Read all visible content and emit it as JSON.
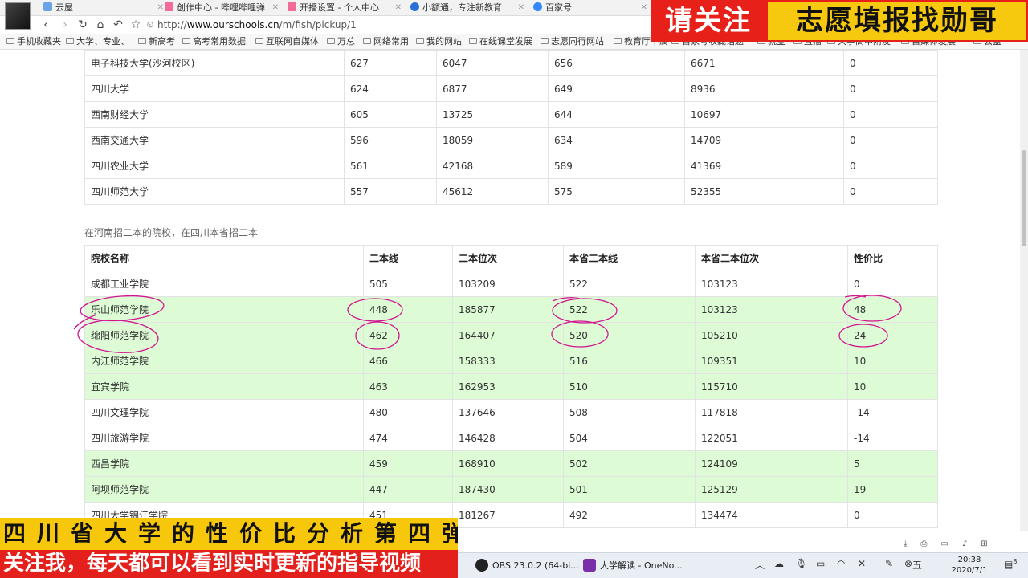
{
  "browser": {
    "tabs": [
      {
        "label": "云屋",
        "color": "#6aa3e8"
      },
      {
        "label": "创作中心 - 哔哩哔哩弹",
        "color": "#f36b9a"
      },
      {
        "label": "开播设置 - 个人中心",
        "color": "#f36b9a"
      },
      {
        "label": "小额通，专注新教育",
        "color": "#2b6fd8"
      },
      {
        "label": "百家号",
        "color": "#3388ff"
      }
    ],
    "url_protocol": "http://",
    "url_host": "www.ourschools.cn",
    "url_path": "/m/fish/pickup/1",
    "bookmarks": [
      "手机收藏夹",
      "大学、专业、",
      "新高考",
      "高考常用数据",
      "互联网自媒体",
      "万总",
      "网络常用",
      "我的网站",
      "在线课堂发展",
      "志愿同行网站",
      "教育厅下属",
      "百家号收藏话题",
      "就业",
      "直播",
      "大学高中附友",
      "自媒体发展",
      "云盘"
    ]
  },
  "overlay": {
    "top_red": "请关注",
    "top_yellow": "志愿填报找勋哥",
    "bottom_yellow": "四川省大学的性价比分析第四弹",
    "bottom_red": "关注我，每天都可以看到实时更新的指导视频"
  },
  "table1": {
    "rows": [
      [
        "电子科技大学(沙河校区)",
        "627",
        "6047",
        "656",
        "6671",
        "0"
      ],
      [
        "四川大学",
        "624",
        "6877",
        "649",
        "8936",
        "0"
      ],
      [
        "西南财经大学",
        "605",
        "13725",
        "644",
        "10697",
        "0"
      ],
      [
        "西南交通大学",
        "596",
        "18059",
        "634",
        "14709",
        "0"
      ],
      [
        "四川农业大学",
        "561",
        "42168",
        "589",
        "41369",
        "0"
      ],
      [
        "四川师范大学",
        "557",
        "45612",
        "575",
        "52355",
        "0"
      ]
    ]
  },
  "table2": {
    "caption": "在河南招二本的院校，在四川本省招二本",
    "headers": [
      "院校名称",
      "二本线",
      "二本位次",
      "本省二本线",
      "本省二本位次",
      "性价比"
    ],
    "rows": [
      {
        "cells": [
          "成都工业学院",
          "505",
          "103209",
          "522",
          "103123",
          "0"
        ],
        "hl": false
      },
      {
        "cells": [
          "乐山师范学院",
          "448",
          "185877",
          "522",
          "103123",
          "48"
        ],
        "hl": true
      },
      {
        "cells": [
          "绵阳师范学院",
          "462",
          "164407",
          "520",
          "105210",
          "24"
        ],
        "hl": true
      },
      {
        "cells": [
          "内江师范学院",
          "466",
          "158333",
          "516",
          "109351",
          "10"
        ],
        "hl": true
      },
      {
        "cells": [
          "宜宾学院",
          "463",
          "162953",
          "510",
          "115710",
          "10"
        ],
        "hl": true
      },
      {
        "cells": [
          "四川文理学院",
          "480",
          "137646",
          "508",
          "117818",
          "-14"
        ],
        "hl": false
      },
      {
        "cells": [
          "四川旅游学院",
          "474",
          "146428",
          "504",
          "122051",
          "-14"
        ],
        "hl": false
      },
      {
        "cells": [
          "西昌学院",
          "459",
          "168910",
          "502",
          "124109",
          "5"
        ],
        "hl": true
      },
      {
        "cells": [
          "阿坝师范学院",
          "447",
          "187430",
          "501",
          "125129",
          "19"
        ],
        "hl": true
      },
      {
        "cells": [
          "四川大学锦江学院",
          "451",
          "181267",
          "492",
          "134474",
          "0"
        ],
        "hl": false
      }
    ]
  },
  "taskbar": {
    "apps": [
      {
        "label": "OBS 23.0.2 (64-bi...",
        "color": "#222222"
      },
      {
        "label": "大学解读 - OneNo...",
        "color": "#7a2fa8"
      }
    ],
    "time": "20:38",
    "date": "2020/7/1",
    "ime": "五",
    "notifications": "8"
  }
}
